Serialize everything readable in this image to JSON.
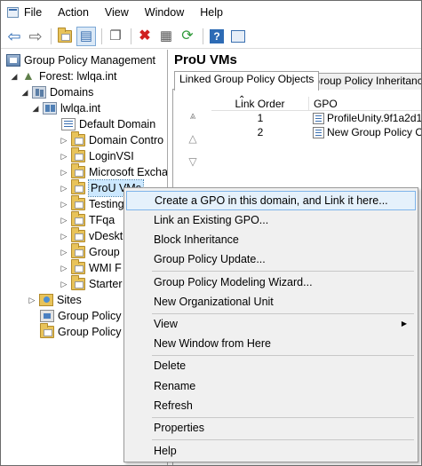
{
  "menubar": {
    "items": [
      "File",
      "Action",
      "View",
      "Window",
      "Help"
    ]
  },
  "toolbar": {
    "buttons": [
      {
        "name": "back-icon",
        "glyph": "⇦",
        "color": "#2d6bb5"
      },
      {
        "name": "forward-icon",
        "glyph": "⇨",
        "color": "#6a6a6a"
      },
      {
        "name": "up-folder-icon",
        "glyph": "▣",
        "color": "#d4a72c"
      },
      {
        "name": "show-hide-tree-icon",
        "glyph": "▤",
        "color": "#3a6fb0"
      },
      {
        "name": "copy-icon",
        "glyph": "❐",
        "color": "#555555"
      },
      {
        "name": "delete-icon",
        "glyph": "✖",
        "color": "#d02020"
      },
      {
        "name": "properties-icon",
        "glyph": "▦",
        "color": "#555555"
      },
      {
        "name": "refresh-icon",
        "glyph": "⟳",
        "color": "#2f9a3a"
      },
      {
        "name": "help-icon",
        "glyph": "?",
        "color": "#ffffff"
      },
      {
        "name": "console-icon",
        "glyph": "▣",
        "color": "#3a6fb0"
      }
    ]
  },
  "tree": {
    "root": "Group Policy Management",
    "forest": "Forest: lwlqa.int",
    "domains": "Domains",
    "domain": "lwlqa.int",
    "children": [
      "Default Domain",
      "Domain Contro",
      "LoginVSI",
      "Microsoft Excha",
      "ProU VMs",
      "Testing",
      "TFqa",
      "vDeskt",
      "Group",
      "WMI F",
      "Starter"
    ],
    "sites": "Sites",
    "modeling": "Group Policy",
    "results": "Group Policy"
  },
  "right": {
    "title": "ProU VMs",
    "tabs": [
      "Linked Group Policy Objects",
      "Group Policy Inheritance"
    ],
    "columns": [
      "Link Order",
      "GPO"
    ],
    "rows": [
      {
        "order": "1",
        "gpo": "ProfileUnity.9f1a2d1..."
      },
      {
        "order": "2",
        "gpo": "New Group Policy O..."
      }
    ]
  },
  "context_menu": {
    "items": [
      "Create a GPO in this domain, and Link it here...",
      "Link an Existing GPO...",
      "Block Inheritance",
      "Group Policy Update...",
      "Group Policy Modeling Wizard...",
      "New Organizational Unit",
      "View",
      "New Window from Here",
      "Delete",
      "Rename",
      "Refresh",
      "Properties",
      "Help"
    ],
    "highlighted": "Create a GPO in this domain, and Link it here..."
  }
}
